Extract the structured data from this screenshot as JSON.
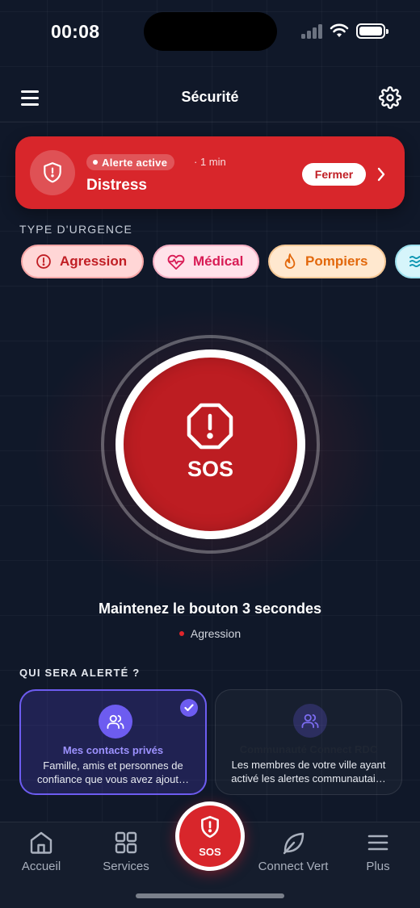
{
  "status_bar": {
    "time": "00:08"
  },
  "header": {
    "title": "Sécurité"
  },
  "alert": {
    "status": "Alerte active",
    "elapsed": "· 1 min",
    "type": "Distress",
    "close_label": "Fermer"
  },
  "emergency_type": {
    "label": "TYPE D'URGENCE",
    "chips": [
      {
        "label": "Agression",
        "icon": "alert-circle-icon",
        "selected": true
      },
      {
        "label": "Médical",
        "icon": "heart-pulse-icon"
      },
      {
        "label": "Pompiers",
        "icon": "flame-icon"
      },
      {
        "label": "",
        "icon": "waves-icon"
      }
    ]
  },
  "sos": {
    "label": "SOS",
    "hold_instruction": "Maintenez le bouton 3 secondes",
    "selected_type": "Agression"
  },
  "alert_targets": {
    "label": "QUI SERA ALERTÉ ?",
    "private": {
      "title": "Mes contacts privés",
      "description": "Famille, amis et personnes de confiance que vous avez ajout…",
      "selected": true
    },
    "community": {
      "title": "Communauté Connect RDC",
      "description": "Les membres de votre ville ayant activé les alertes communautai…",
      "selected": false
    }
  },
  "bottom_nav": {
    "home": "Accueil",
    "services": "Services",
    "sos": "SOS",
    "connect_vert": "Connect Vert",
    "more": "Plus"
  },
  "colors": {
    "background": "#101829",
    "alert_red": "#d8262b",
    "sos_red": "#bd1d22",
    "accent_purple": "#6d5cf0"
  }
}
